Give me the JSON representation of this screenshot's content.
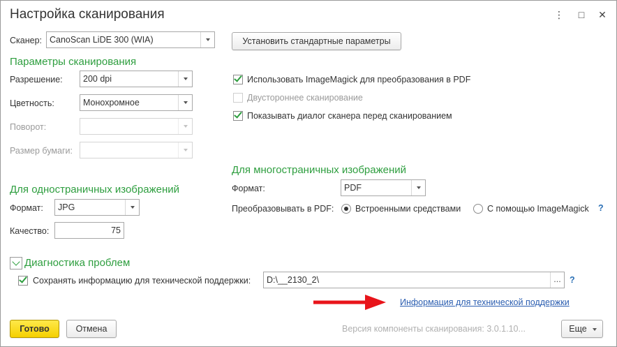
{
  "window": {
    "title": "Настройка сканирования",
    "controls": {
      "menu": "⋮",
      "maximize": "□",
      "close": "✕"
    }
  },
  "scanner": {
    "label": "Сканер:",
    "value": "CanoScan LiDE 300 (WIA)",
    "reset_button": "Установить стандартные параметры"
  },
  "scan_params": {
    "section_title": "Параметры сканирования",
    "resolution": {
      "label": "Разрешение:",
      "value": "200 dpi"
    },
    "color": {
      "label": "Цветность:",
      "value": "Монохромное"
    },
    "rotation": {
      "label": "Поворот:",
      "value": ""
    },
    "paper_size": {
      "label": "Размер бумаги:",
      "value": ""
    }
  },
  "options": {
    "use_imagemagick": {
      "label": "Использовать ImageMagick для преобразования в PDF",
      "checked": true
    },
    "duplex": {
      "label": "Двустороннее сканирование",
      "checked": false,
      "disabled": true
    },
    "show_dialog": {
      "label": "Показывать диалог сканера перед сканированием",
      "checked": true
    }
  },
  "single_page": {
    "section_title": "Для одностраничных изображений",
    "format": {
      "label": "Формат:",
      "value": "JPG"
    },
    "quality": {
      "label": "Качество:",
      "value": "75"
    }
  },
  "multi_page": {
    "section_title": "Для многостраничных изображений",
    "format": {
      "label": "Формат:",
      "value": "PDF"
    },
    "convert": {
      "label": "Преобразовывать в PDF:",
      "options": [
        "Встроенными средствами",
        "С помощью ImageMagick"
      ],
      "selected": "Встроенными средствами",
      "help": "?"
    }
  },
  "diagnostics": {
    "section_title": "Диагностика проблем",
    "save_info": {
      "label": "Сохранять информацию для технической поддержки:",
      "checked": true
    },
    "path": "D:\\__2130_2\\",
    "browse": "...",
    "help": "?",
    "support_link": "Информация для технической поддержки",
    "arrow_color": "#e8141a"
  },
  "footer": {
    "ok_button": "Готово",
    "cancel_button": "Отмена",
    "version_text": "Версия компоненты сканирования: 3.0.1.10...",
    "more_button": "Еще"
  },
  "colors": {
    "accent_green": "#2e9e3f",
    "primary_yellow": "#f5d000",
    "link_blue": "#2a5db0"
  }
}
